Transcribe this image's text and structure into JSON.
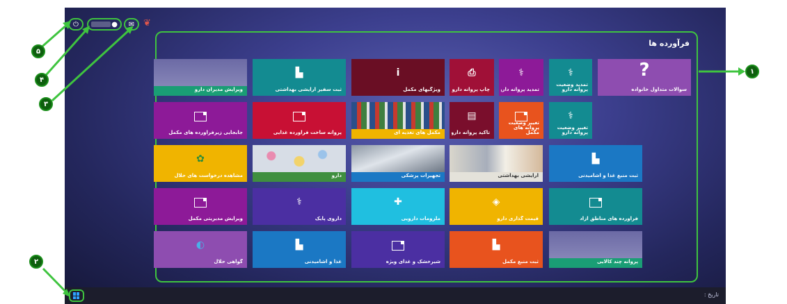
{
  "screen": {
    "panel_title": "فرآورده ها",
    "taskbar_date_label": "تاریخ :",
    "top_icons": [
      "power-icon",
      "user-icon",
      "mail-icon"
    ]
  },
  "tiles": {
    "t1": "سوالات متداول خانواده",
    "t2": "تمدید وضعیت پروانه دارو",
    "t3": "تمدید پروانه دارو",
    "t4": "چاپ پروانه دارو",
    "t5": "ویژگیهای مکمل",
    "t6": "ثبت سفیر آرایشی بهداشتی",
    "t7": "ویرایش مدیران دارو",
    "t8": "تغییر وضعیت پروانه دارو",
    "t9": "تغییر وضعیت پروانه های مکمل",
    "t10": "تاکید پروانه دارو",
    "t11": "مکمل های تغذیه ای",
    "t12": "پروانه ساخت فرآورده غذایی",
    "t13": "جابجایی زیرفرآورده های مکمل",
    "t14": "ثبت منبع غذا و آشامیدنی",
    "t15": "آرایشی بهداشتی",
    "t16": "تجهیزات پزشکی",
    "t17": "دارو",
    "t18": "مشاهده درخواست های حلال",
    "t19": "فرآورده های مناطق آزاد",
    "t20": "قیمت گذاری دارو",
    "t21": "ملزومات دارویی",
    "t22": "داروی پایک",
    "t23": "ویرایش مدیریتی مکمل",
    "t24": "پروانه چند کالایی",
    "t25": "ثبت منبع مکمل",
    "t26": "شیرخشک و غذای ویژه",
    "t27": "غذا و آشامیدنی",
    "t28": "گواهی حلال"
  },
  "annotations": [
    "۱",
    "۲",
    "۳",
    "۴",
    "۵"
  ],
  "colors": {
    "highlight": "#3fc43f",
    "annotation_fill": "#0e5f0e"
  }
}
